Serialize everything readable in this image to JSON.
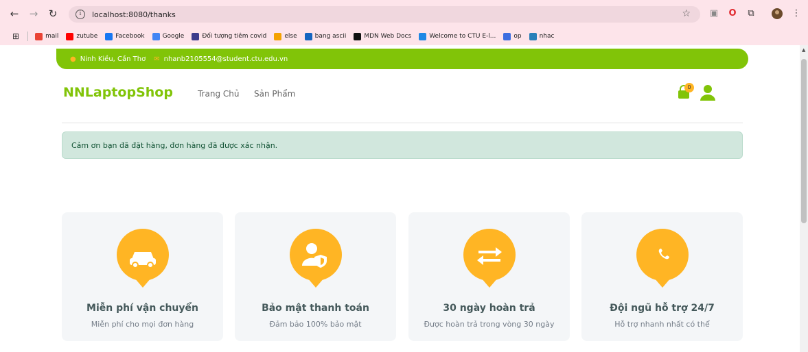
{
  "browser": {
    "url": "localhost:8080/thanks",
    "bookmarks": [
      {
        "label": "mail",
        "icon": "gmail-icon",
        "color": "#ea4335"
      },
      {
        "label": "zutube",
        "icon": "youtube-icon",
        "color": "#ff0000"
      },
      {
        "label": "Facebook",
        "icon": "facebook-icon",
        "color": "#1877f2"
      },
      {
        "label": "Google",
        "icon": "google-icon",
        "color": "#4285f4"
      },
      {
        "label": "Đối tượng tiêm covid",
        "icon": "covid-icon",
        "color": "#3c3c8c"
      },
      {
        "label": "else",
        "icon": "else-icon",
        "color": "#f4a100"
      },
      {
        "label": "bang ascii",
        "icon": "ascii-icon",
        "color": "#1565c0"
      },
      {
        "label": "MDN Web Docs",
        "icon": "mdn-icon",
        "color": "#111111"
      },
      {
        "label": "Welcome to CTU E-l...",
        "icon": "ctu-icon",
        "color": "#1e88e5"
      },
      {
        "label": "op",
        "icon": "op-icon",
        "color": "#3d6ee0"
      },
      {
        "label": "nhac",
        "icon": "nhac-icon",
        "color": "#2980b9"
      }
    ]
  },
  "topbar": {
    "address": "Ninh Kiều, Cần Thơ",
    "email": "nhanb2105554@student.ctu.edu.vn"
  },
  "navbar": {
    "brand": "NNLaptopShop",
    "links": [
      "Trang Chủ",
      "Sản Phẩm"
    ],
    "cart_count": "0"
  },
  "alert": {
    "message": "Cảm ơn bạn đã đặt hàng, đơn hàng đã được xác nhận."
  },
  "features": [
    {
      "icon": "car-icon",
      "title": "Miễn phí vận chuyển",
      "subtitle": "Miễn phí cho mọi đơn hàng"
    },
    {
      "icon": "user-shield-icon",
      "title": "Bảo mật thanh toán",
      "subtitle": "Đảm bảo 100% bảo mật"
    },
    {
      "icon": "exchange-icon",
      "title": "30 ngày hoàn trả",
      "subtitle": "Được hoàn trả trong vòng 30 ngày"
    },
    {
      "icon": "phone-icon",
      "title": "Đội ngũ hỗ trợ 24/7",
      "subtitle": "Hỗ trợ nhanh nhất có thể"
    }
  ],
  "colors": {
    "brand_green": "#81c408",
    "accent_orange": "#ffb524",
    "alert_bg": "#d1e7dd",
    "card_bg": "#f4f6f8"
  }
}
